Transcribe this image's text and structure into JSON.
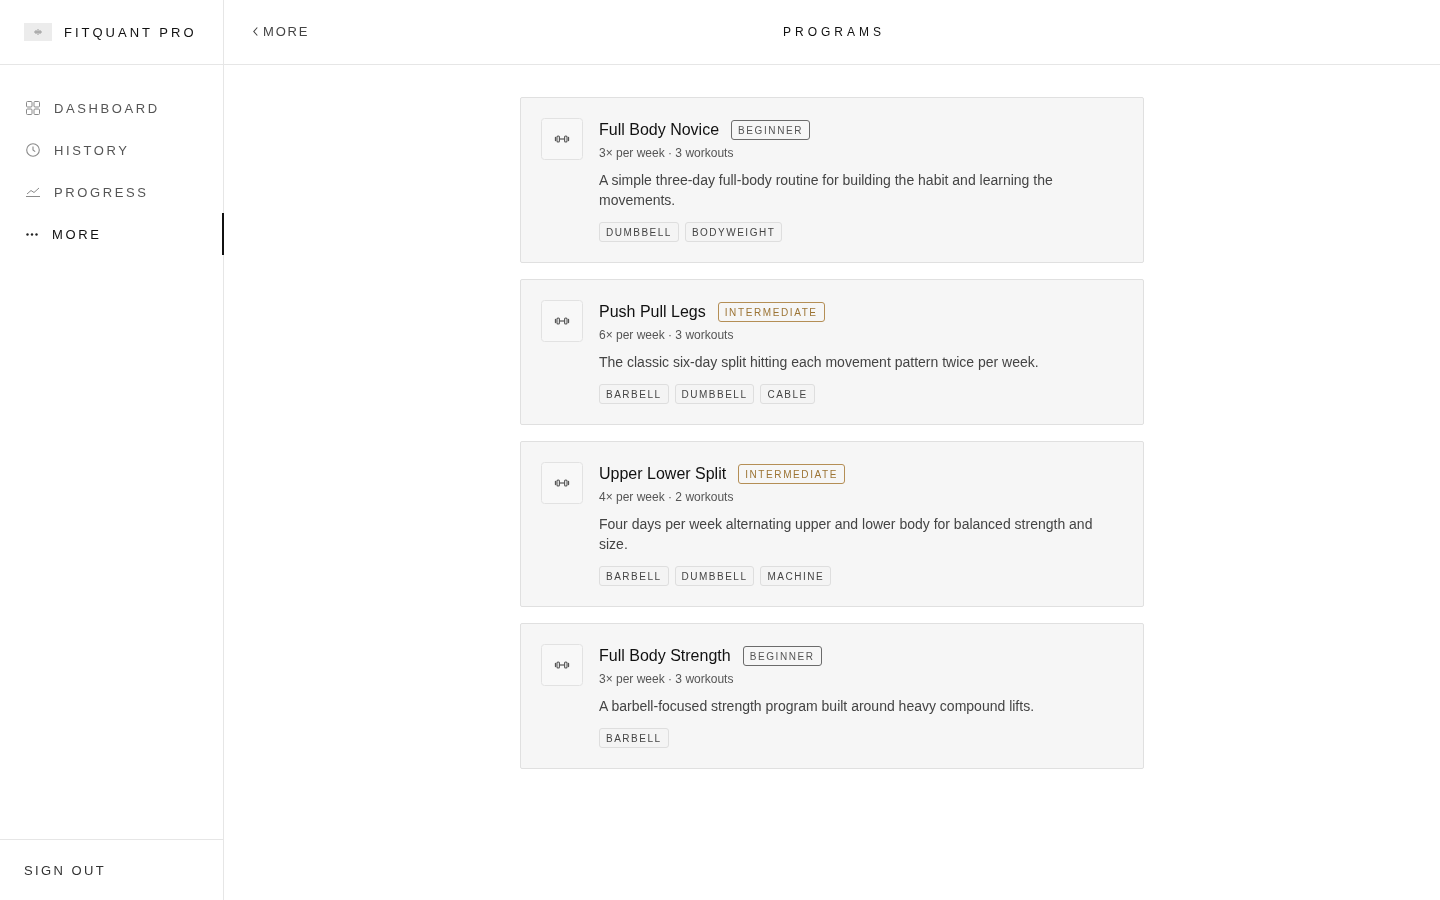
{
  "brand": {
    "name": "FITQUANT PRO"
  },
  "sidebar": {
    "items": [
      {
        "label": "DASHBOARD",
        "selected": false
      },
      {
        "label": "HISTORY",
        "selected": false
      },
      {
        "label": "PROGRESS",
        "selected": false
      },
      {
        "label": "MORE",
        "selected": true
      }
    ],
    "sign_out": "SIGN OUT"
  },
  "header": {
    "back": "MORE",
    "title": "PROGRAMS"
  },
  "programs": [
    {
      "name": "Full Body Novice",
      "difficulty": {
        "label": "BEGINNER",
        "kind": "beginner"
      },
      "meta": "3× per week · 3 workouts",
      "description": "A simple three-day full-body routine for building the habit and learning the movements.",
      "tags": [
        "DUMBBELL",
        "BODYWEIGHT"
      ]
    },
    {
      "name": "Push Pull Legs",
      "difficulty": {
        "label": "INTERMEDIATE",
        "kind": "intermediate"
      },
      "meta": "6× per week · 3 workouts",
      "description": "The classic six-day split hitting each movement pattern twice per week.",
      "tags": [
        "BARBELL",
        "DUMBBELL",
        "CABLE"
      ]
    },
    {
      "name": "Upper Lower Split",
      "difficulty": {
        "label": "INTERMEDIATE",
        "kind": "intermediate"
      },
      "meta": "4× per week · 2 workouts",
      "description": "Four days per week alternating upper and lower body for balanced strength and size.",
      "tags": [
        "BARBELL",
        "DUMBBELL",
        "MACHINE"
      ]
    },
    {
      "name": "Full Body Strength",
      "difficulty": {
        "label": "BEGINNER",
        "kind": "beginner"
      },
      "meta": "3× per week · 3 workouts",
      "description": "A barbell-focused strength program built around heavy compound lifts.",
      "tags": [
        "BARBELL"
      ]
    }
  ]
}
